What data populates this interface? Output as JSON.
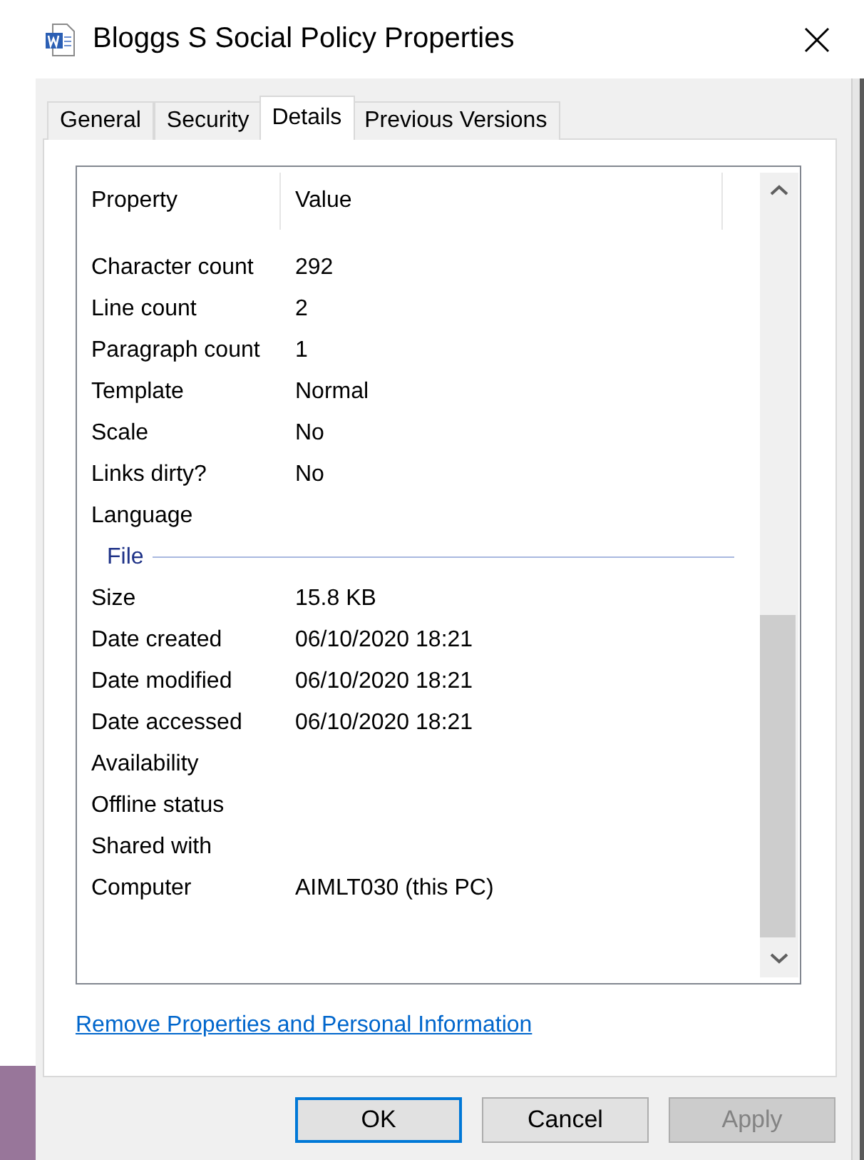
{
  "window": {
    "title": "Bloggs S Social Policy Properties"
  },
  "tabs": [
    {
      "label": "General",
      "selected": false
    },
    {
      "label": "Security",
      "selected": false
    },
    {
      "label": "Details",
      "selected": true
    },
    {
      "label": "Previous Versions",
      "selected": false
    }
  ],
  "table": {
    "columns": [
      "Property",
      "Value"
    ],
    "rows": [
      {
        "kind": "row",
        "property": "Character count",
        "value": "292"
      },
      {
        "kind": "row",
        "property": "Line count",
        "value": "2"
      },
      {
        "kind": "row",
        "property": "Paragraph count",
        "value": "1"
      },
      {
        "kind": "row",
        "property": "Template",
        "value": "Normal"
      },
      {
        "kind": "row",
        "property": "Scale",
        "value": "No"
      },
      {
        "kind": "row",
        "property": "Links dirty?",
        "value": "No"
      },
      {
        "kind": "row",
        "property": "Language"
      },
      {
        "kind": "section",
        "property": "File"
      },
      {
        "kind": "row",
        "property": "Size",
        "value": "15.8 KB"
      },
      {
        "kind": "row",
        "property": "Date created",
        "value": "06/10/2020 18:21"
      },
      {
        "kind": "row",
        "property": "Date modified",
        "value": "06/10/2020 18:21"
      },
      {
        "kind": "row",
        "property": "Date accessed",
        "value": "06/10/2020 18:21"
      },
      {
        "kind": "row",
        "property": "Availability"
      },
      {
        "kind": "row",
        "property": "Offline status"
      },
      {
        "kind": "row",
        "property": "Shared with"
      },
      {
        "kind": "row",
        "property": "Computer",
        "value": "AIMLT030 (this PC)"
      }
    ]
  },
  "link": "Remove Properties and Personal Information",
  "buttons": [
    {
      "label": "OK",
      "default": true,
      "disabled": false
    },
    {
      "label": "Cancel",
      "default": false,
      "disabled": false
    },
    {
      "label": "Apply",
      "default": false,
      "disabled": true
    }
  ]
}
